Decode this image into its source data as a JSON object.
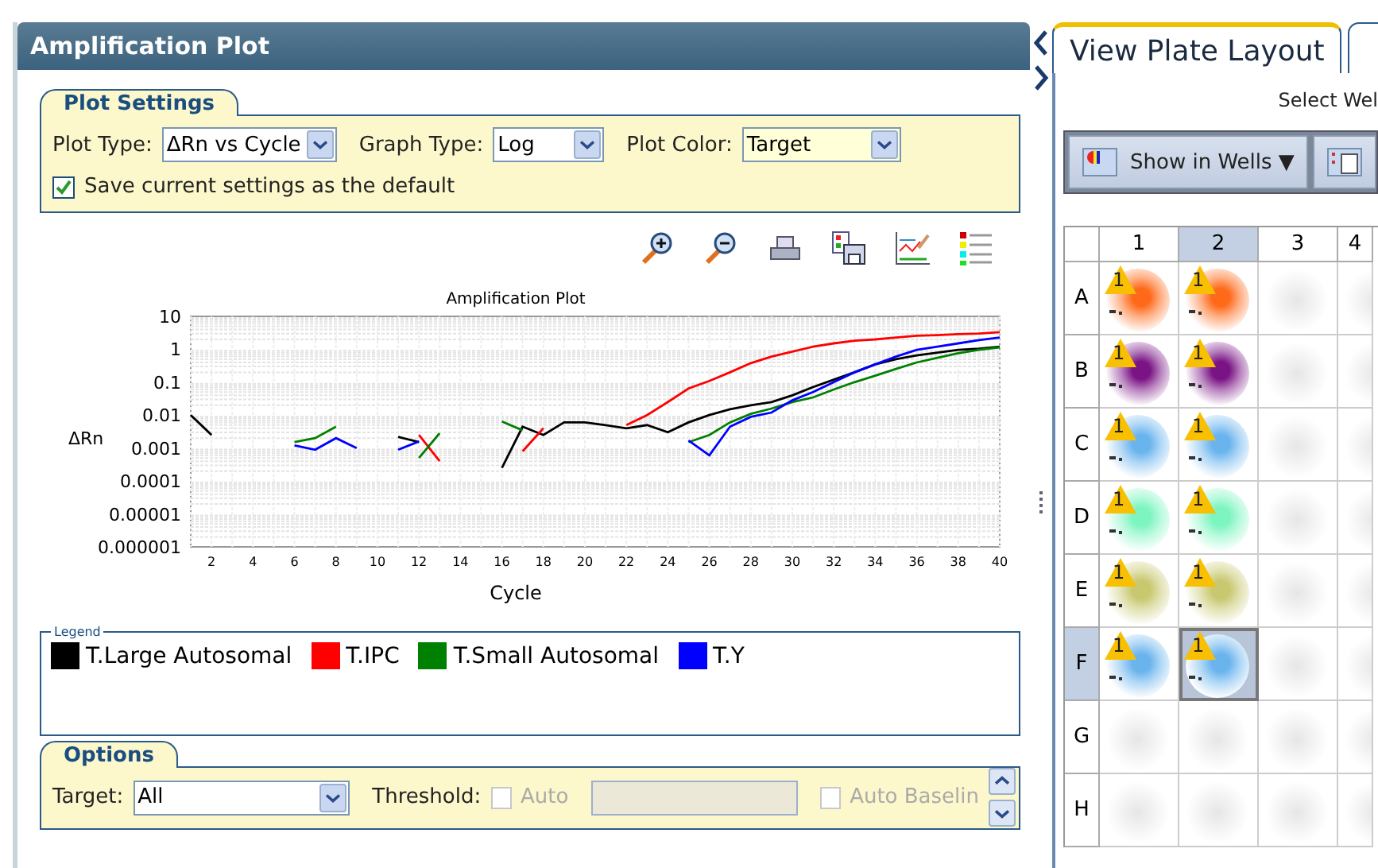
{
  "left_panel": {
    "title": "Amplification Plot",
    "plot_settings": {
      "title": "Plot Settings",
      "fields": [
        {
          "label": "Plot Type:",
          "value": "ΔRn vs Cycle",
          "highlighted": false
        },
        {
          "label": "Graph Type:",
          "value": "Log",
          "highlighted": false
        },
        {
          "label": "Plot Color:",
          "value": "Target",
          "highlighted": true
        }
      ],
      "save_default": {
        "label": "Save current settings as the default",
        "checked": true
      }
    },
    "plot": {
      "title": "Amplification Plot",
      "xlabel": "Cycle",
      "ylabel": "ΔRn",
      "x_tick_labels": [
        "2",
        "4",
        "6",
        "8",
        "10",
        "12",
        "14",
        "16",
        "18",
        "20",
        "22",
        "24",
        "26",
        "28",
        "30",
        "32",
        "34",
        "36",
        "38",
        "40"
      ],
      "y_tick_labels": [
        "10",
        "1",
        "0.1",
        "0.01",
        "0.001",
        "0.0001",
        "0.00001",
        "0.000001"
      ],
      "series": [
        {
          "name": "T.Large Autosomal",
          "color": "#000000"
        },
        {
          "name": "T.IPC",
          "color": "#ff0000"
        },
        {
          "name": "T.Small Autosomal",
          "color": "#008000"
        },
        {
          "name": "T.Y",
          "color": "#0000ff"
        }
      ]
    },
    "legend": {
      "title": "Legend"
    },
    "options": {
      "title": "Options",
      "target_label": "Target:",
      "target_value": "All",
      "threshold_label": "Threshold:",
      "auto": {
        "label": "Auto",
        "checked": false,
        "disabled": true
      },
      "threshold_value_disabled": true,
      "auto_baseline": {
        "label": "Auto Baselin",
        "checked": false,
        "disabled": true
      }
    }
  },
  "right_panel": {
    "tabs": [
      {
        "label": "View Plate Layout",
        "selected": true
      },
      {
        "selected": false
      }
    ],
    "select_text": "Select Wel",
    "show_in_wells": "Show in Wells ▼",
    "plate": {
      "columns": [
        {
          "label": "1",
          "selected": false
        },
        {
          "label": "2",
          "selected": true
        },
        {
          "label": "3",
          "selected": false
        },
        {
          "label": "4",
          "selected": false
        }
      ],
      "rows": [
        {
          "label": "A",
          "selected": false,
          "wells": [
            {
              "color": "#ff6a1a",
              "flag": "1",
              "selected": false
            },
            {
              "color": "#ff6a1a",
              "flag": "1",
              "selected": false
            },
            {
              "selected": false
            },
            {
              "selected": false
            }
          ]
        },
        {
          "label": "B",
          "selected": false,
          "wells": [
            {
              "color": "#7a1485",
              "flag": "1",
              "selected": false
            },
            {
              "color": "#7a1485",
              "flag": "1",
              "selected": false
            },
            {
              "selected": false
            },
            {
              "selected": false
            }
          ]
        },
        {
          "label": "C",
          "selected": false,
          "wells": [
            {
              "color": "#6ab4ee",
              "flag": "1",
              "selected": false
            },
            {
              "color": "#6ab4ee",
              "flag": "1",
              "selected": false
            },
            {
              "selected": false
            },
            {
              "selected": false
            }
          ]
        },
        {
          "label": "D",
          "selected": false,
          "wells": [
            {
              "color": "#7cf5c0",
              "flag": "1",
              "selected": false
            },
            {
              "color": "#7cf5c0",
              "flag": "1",
              "selected": false
            },
            {
              "selected": false
            },
            {
              "selected": false
            }
          ]
        },
        {
          "label": "E",
          "selected": false,
          "wells": [
            {
              "color": "#c8c870",
              "flag": "1",
              "selected": false
            },
            {
              "color": "#c8c870",
              "flag": "1",
              "selected": false
            },
            {
              "selected": false
            },
            {
              "selected": false
            }
          ]
        },
        {
          "label": "F",
          "selected": true,
          "wells": [
            {
              "color": "#6ab4ee",
              "flag": "1",
              "selected": false
            },
            {
              "color": "#6ab4ee",
              "flag": "1",
              "selected": true
            },
            {
              "selected": false
            },
            {
              "selected": false
            }
          ]
        },
        {
          "label": "G",
          "selected": false,
          "wells": [
            {
              "selected": false
            },
            {
              "selected": false
            },
            {
              "selected": false
            },
            {
              "selected": false
            }
          ]
        },
        {
          "label": "H",
          "selected": false,
          "wells": [
            {
              "selected": false
            },
            {
              "selected": false
            },
            {
              "selected": false
            },
            {
              "selected": false
            }
          ]
        }
      ]
    }
  }
}
